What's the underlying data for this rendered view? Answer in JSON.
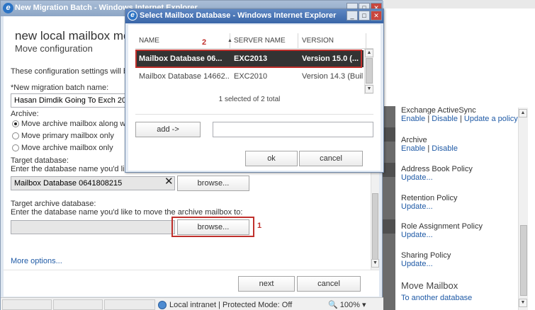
{
  "main_window": {
    "title": "New Migration Batch - Windows Internet Explorer",
    "heading": "new local mailbox move",
    "subheading": "Move configuration",
    "intro": "These configuration settings will be a",
    "batch_label": "*New migration batch name:",
    "batch_value": "Hasan Dimdik Going To Exch 2013",
    "archive_label": "Archive:",
    "archive_options": [
      {
        "label": "Move archive mailbox along with",
        "selected": true
      },
      {
        "label": "Move primary mailbox only",
        "selected": false
      },
      {
        "label": "Move archive mailbox only",
        "selected": false
      }
    ],
    "target_db_label": "Target database:",
    "target_db_hint": "Enter the database name you'd like to",
    "target_db_value": "Mailbox Database 0641808215",
    "browse_label": "browse...",
    "target_archive_label": "Target archive database:",
    "target_archive_hint": "Enter the database name you'd like to move the archive mailbox to:",
    "more_options": "More options...",
    "next_label": "next",
    "cancel_label": "cancel"
  },
  "annotations": {
    "one": "1",
    "two": "2"
  },
  "statusbar": {
    "zone": "Local intranet | Protected Mode: Off",
    "zoom": "100%"
  },
  "dialog": {
    "title": "Select Mailbox Database - Windows Internet Explorer",
    "columns": [
      "NAME",
      "SERVER NAME",
      "VERSION"
    ],
    "rows": [
      {
        "name": "Mailbox Database 06...",
        "server": "EXC2013",
        "version": "Version 15.0 (...",
        "selected": true
      },
      {
        "name": "Mailbox Database 14662...",
        "server": "EXC2010",
        "version": "Version 14.3 (Buil...",
        "selected": false
      }
    ],
    "count": "1 selected of 2 total",
    "add_label": "add ->",
    "ok_label": "ok",
    "cancel_label": "cancel"
  },
  "right_panel": {
    "sections": [
      {
        "title": "Exchange ActiveSync",
        "links": [
          "Enable",
          "Disable",
          "Update a policy..."
        ]
      },
      {
        "title": "Archive",
        "links": [
          "Enable",
          "Disable"
        ]
      },
      {
        "title": "Address Book Policy",
        "links": [
          "Update..."
        ]
      },
      {
        "title": "Retention Policy",
        "links": [
          "Update..."
        ]
      },
      {
        "title": "Role Assignment Policy",
        "links": [
          "Update..."
        ]
      },
      {
        "title": "Sharing Policy",
        "links": [
          "Update..."
        ]
      },
      {
        "title": "Move Mailbox",
        "links": [
          "To another database"
        ]
      }
    ]
  },
  "colors": {
    "selected_row": "#333333",
    "annotation": "#c0302c",
    "link": "#1f5aa6"
  }
}
